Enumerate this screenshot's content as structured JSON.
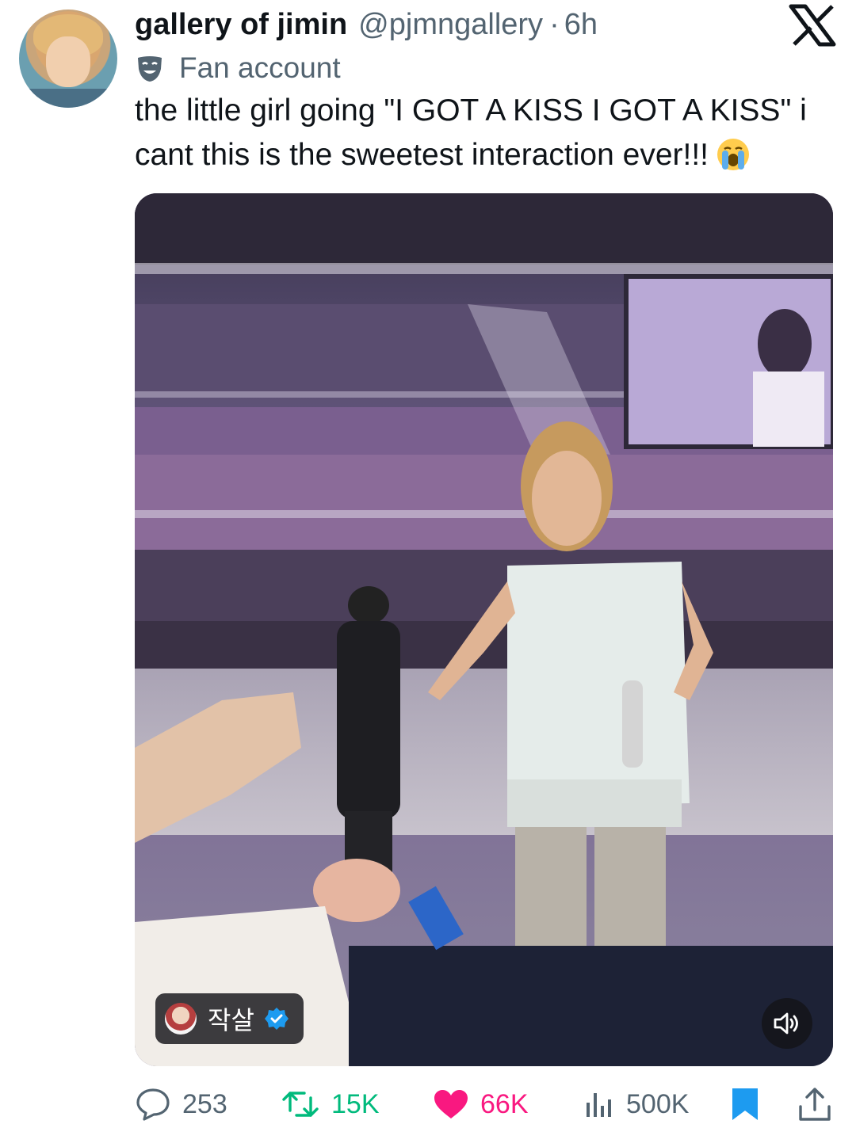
{
  "tweet": {
    "display_name": "gallery of jimin",
    "handle": "@pjmngallery",
    "separator": "·",
    "time_ago": "6h",
    "account_label": "Fan account",
    "text": "the little girl going \"I GOT A KISS I GOT A KISS\" i cant this is the sweetest interaction ever!!!",
    "emoji": "loudly-crying-face-emoji"
  },
  "media": {
    "credit_name": "작살",
    "credit_verified": true,
    "sound_icon": "speaker-muted-icon"
  },
  "actions": {
    "replies": "253",
    "retweets": "15K",
    "likes": "66K",
    "views": "500K",
    "bookmark_icon": "bookmark-filled-icon",
    "share_icon": "share-icon"
  },
  "colors": {
    "text_primary": "#0f1419",
    "text_secondary": "#536471",
    "retweet_green": "#00ba7c",
    "like_pink": "#f91880",
    "bookmark_blue": "#1d9bf0",
    "verified_blue": "#1d9bf0"
  }
}
